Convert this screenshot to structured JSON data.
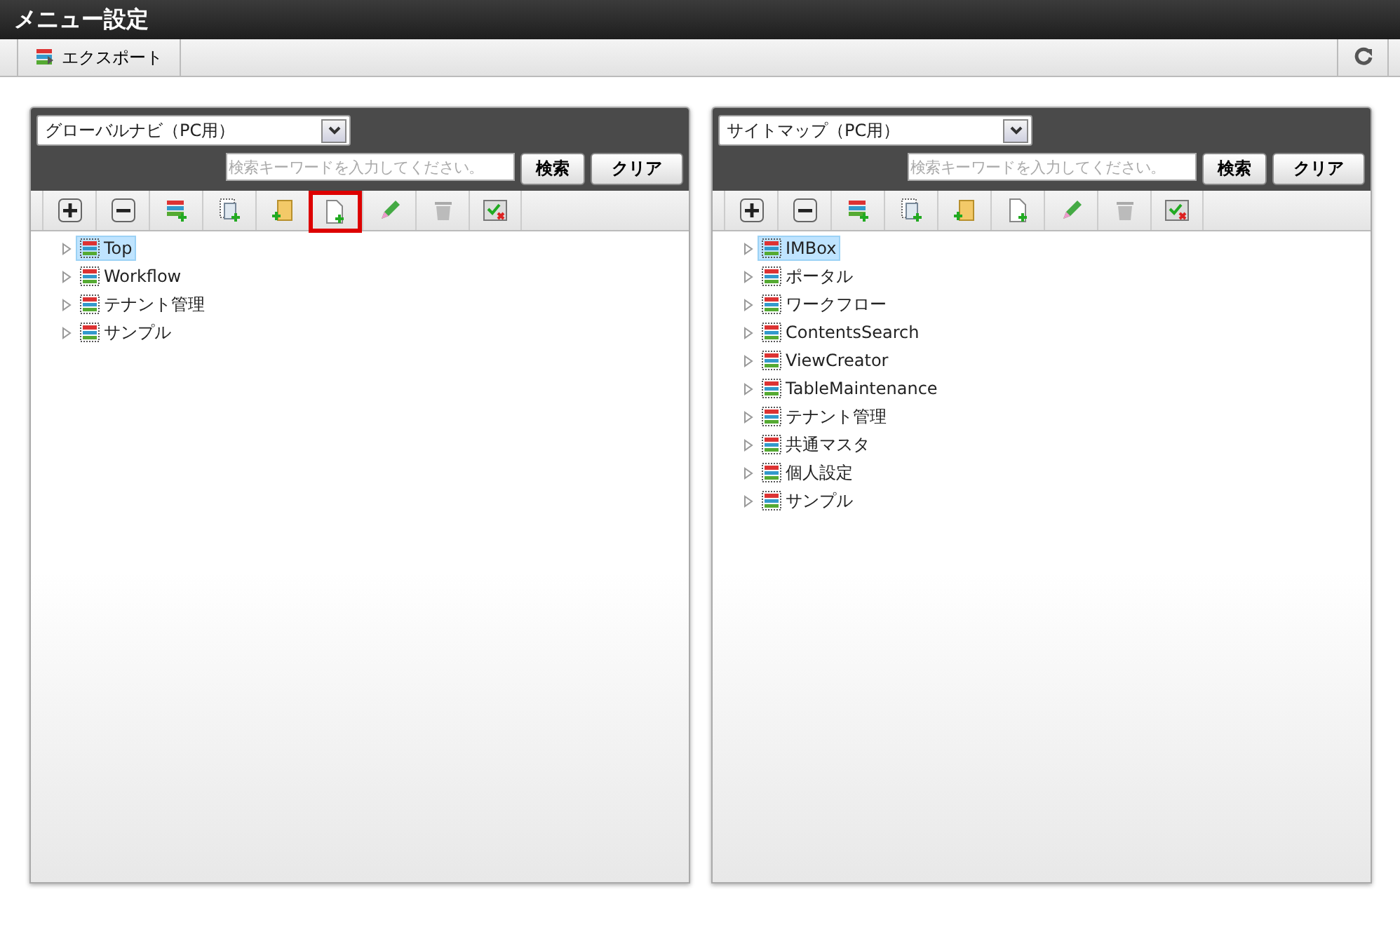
{
  "title": "メニュー設定",
  "toolbar": {
    "export_label": "エクスポート"
  },
  "panels": [
    {
      "select": "グローバルナビ（PC用）",
      "search_placeholder": "検索キーワードを入力してください。",
      "search_button": "検索",
      "clear_button": "クリア",
      "tools": [
        {
          "kind": "expand",
          "highlighted": false
        },
        {
          "kind": "collapse",
          "highlighted": false
        },
        {
          "kind": "add-list",
          "highlighted": false
        },
        {
          "kind": "add-copy",
          "highlighted": false
        },
        {
          "kind": "add-folder",
          "highlighted": false
        },
        {
          "kind": "add-page",
          "highlighted": true
        },
        {
          "kind": "edit",
          "highlighted": false
        },
        {
          "kind": "delete",
          "highlighted": false
        },
        {
          "kind": "check",
          "highlighted": false
        }
      ],
      "items": [
        {
          "label": "Top",
          "selected": true
        },
        {
          "label": "Workflow",
          "selected": false
        },
        {
          "label": "テナント管理",
          "selected": false
        },
        {
          "label": "サンプル",
          "selected": false
        }
      ]
    },
    {
      "select": "サイトマップ（PC用）",
      "search_placeholder": "検索キーワードを入力してください。",
      "search_button": "検索",
      "clear_button": "クリア",
      "tools": [
        {
          "kind": "expand",
          "highlighted": false
        },
        {
          "kind": "collapse",
          "highlighted": false
        },
        {
          "kind": "add-list",
          "highlighted": false
        },
        {
          "kind": "add-copy",
          "highlighted": false
        },
        {
          "kind": "add-folder",
          "highlighted": false
        },
        {
          "kind": "add-page",
          "highlighted": false
        },
        {
          "kind": "edit",
          "highlighted": false
        },
        {
          "kind": "delete",
          "highlighted": false
        },
        {
          "kind": "check",
          "highlighted": false
        }
      ],
      "items": [
        {
          "label": "IMBox",
          "selected": true
        },
        {
          "label": "ポータル",
          "selected": false
        },
        {
          "label": "ワークフロー",
          "selected": false
        },
        {
          "label": "ContentsSearch",
          "selected": false
        },
        {
          "label": "ViewCreator",
          "selected": false
        },
        {
          "label": "TableMaintenance",
          "selected": false
        },
        {
          "label": "テナント管理",
          "selected": false
        },
        {
          "label": "共通マスタ",
          "selected": false
        },
        {
          "label": "個人設定",
          "selected": false
        },
        {
          "label": "サンプル",
          "selected": false
        }
      ]
    }
  ]
}
